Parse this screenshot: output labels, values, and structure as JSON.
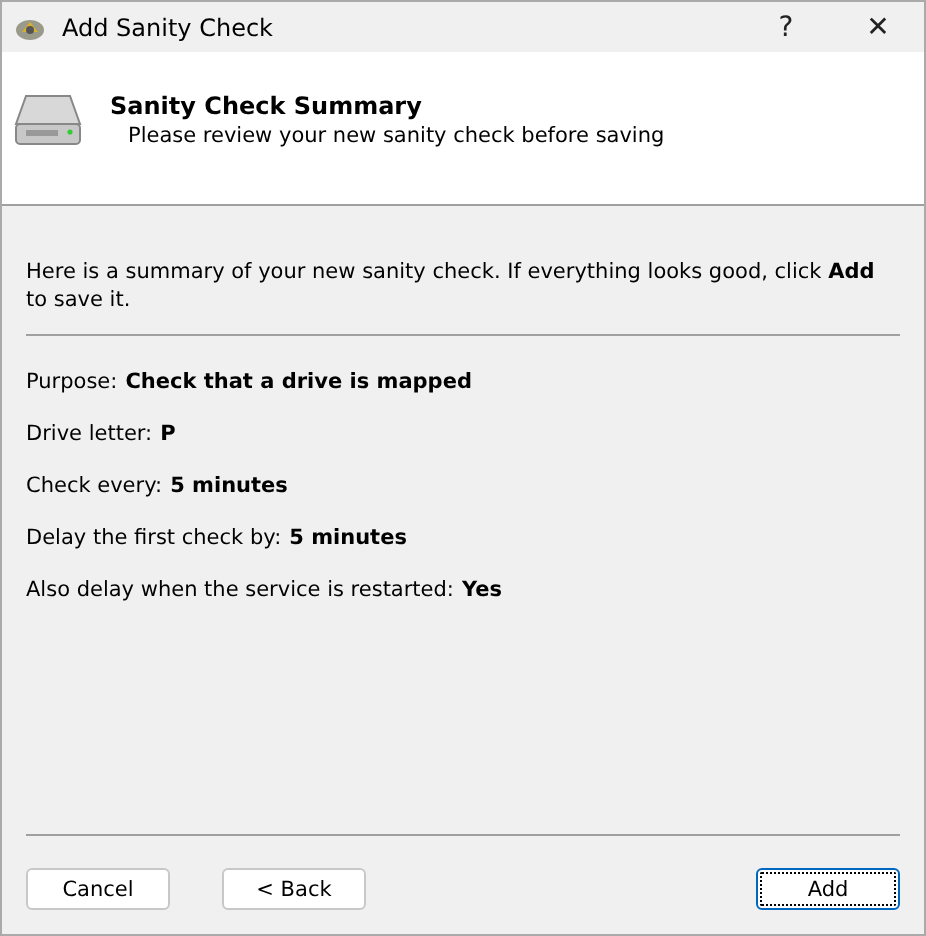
{
  "window": {
    "title": "Add Sanity Check",
    "help": "?",
    "close": "✕"
  },
  "header": {
    "title": "Sanity Check Summary",
    "subtitle": "Please review your new sanity check before saving"
  },
  "intro": "Here is a summary of your new sanity check. If everything looks good, click **Add** to save it.",
  "fields": [
    {
      "label": "Purpose:",
      "value": "Check that a drive is mapped"
    },
    {
      "label": "Drive letter:",
      "value": "P"
    },
    {
      "label": "Check every:",
      "value": "5 minutes"
    },
    {
      "label": "Delay the first check by:",
      "value": "5 minutes"
    },
    {
      "label": "Also delay when the service is restarted:",
      "value": "Yes"
    }
  ],
  "buttons": [
    {
      "label": "Cancel",
      "focused": false
    },
    {
      "label": "< Back",
      "focused": false
    },
    {
      "label": "Add",
      "focused": true
    }
  ]
}
